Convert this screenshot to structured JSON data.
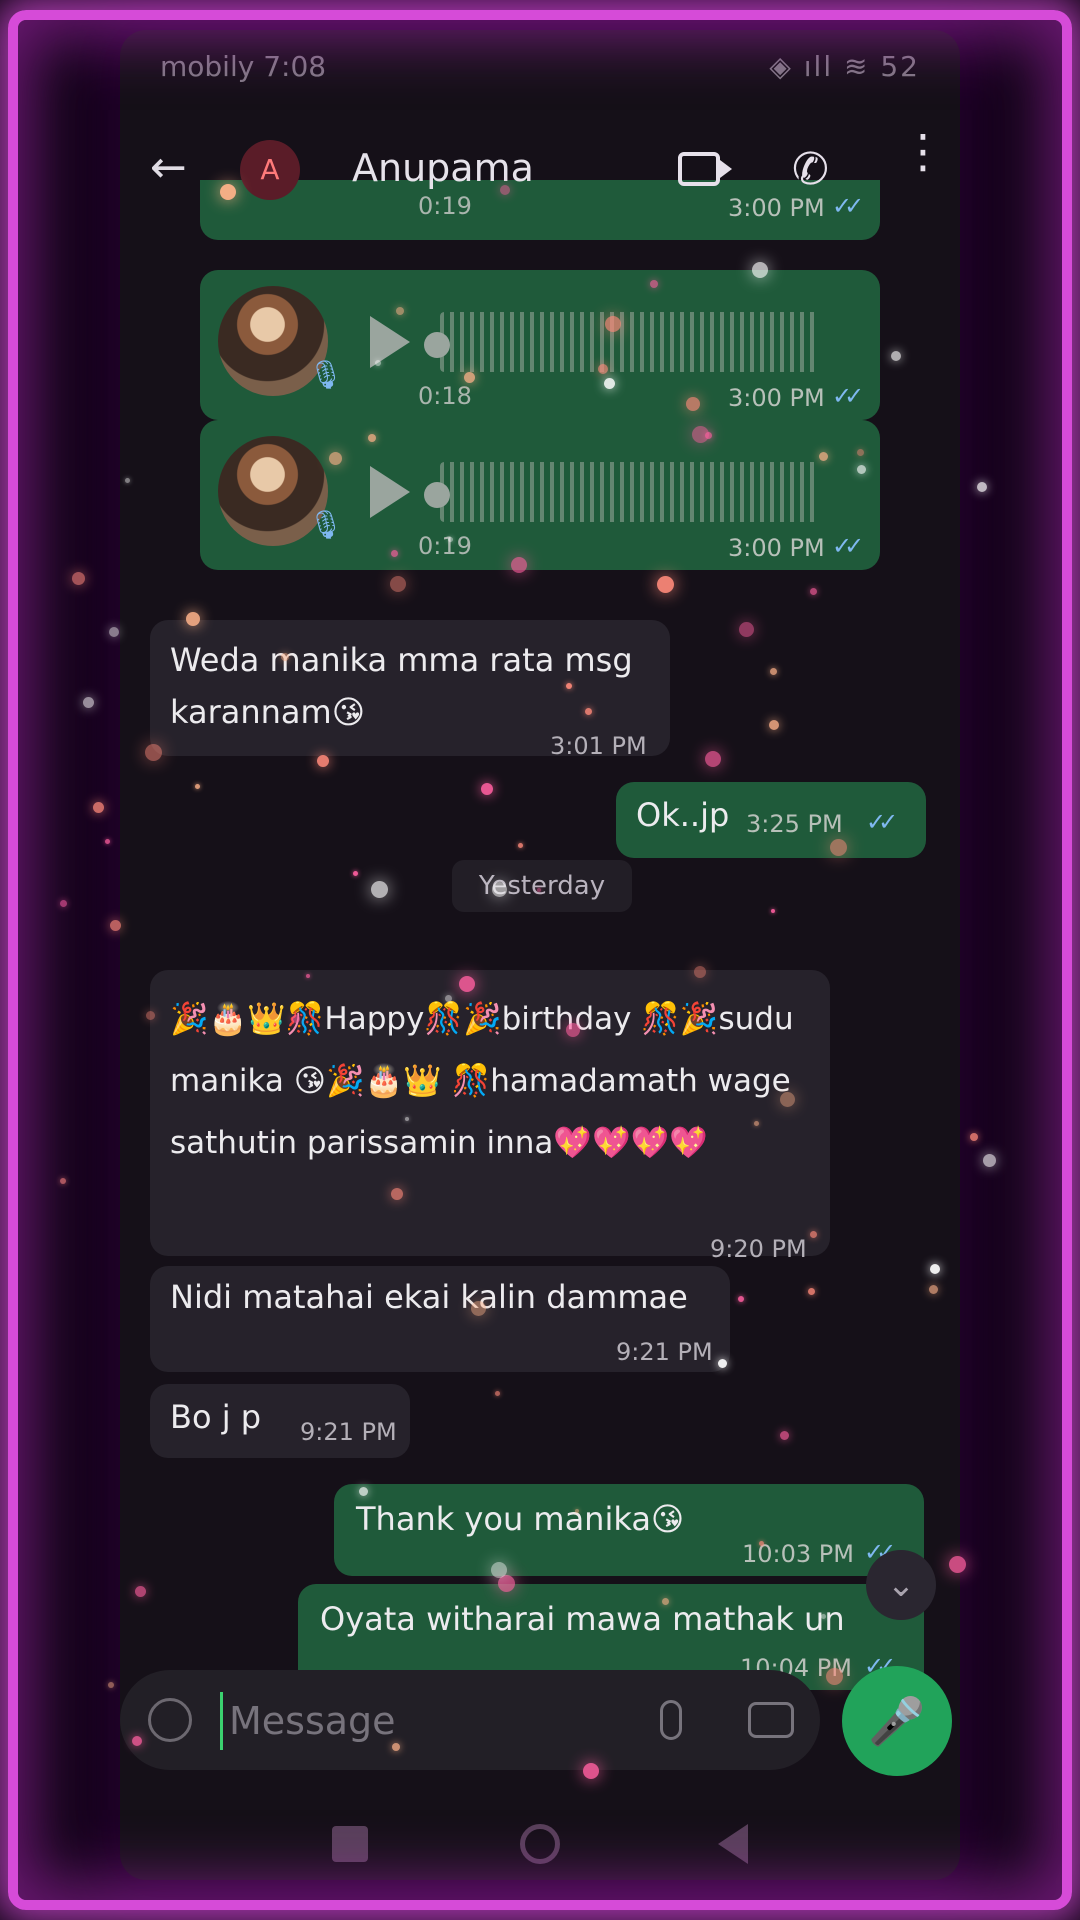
{
  "status_bar": {
    "carrier_time": "mobily  7:08",
    "indicators": "◈ ıll ≋ 52"
  },
  "header": {
    "contact_name": "Anupama",
    "avatar_initial": "A"
  },
  "voice_notes": [
    {
      "duration": "0:19",
      "time": "3:00 PM",
      "ticks": "✓✓"
    },
    {
      "duration": "0:18",
      "time": "3:00 PM",
      "ticks": "✓✓"
    },
    {
      "duration": "0:19",
      "time": "3:00 PM",
      "ticks": "✓✓"
    }
  ],
  "messages": [
    {
      "direction": "in",
      "text": "Weda manika mma rata msg karannam😘",
      "time": "3:01 PM"
    },
    {
      "direction": "out",
      "text": "Ok..jp",
      "time": "3:25 PM",
      "ticks": "✓✓"
    },
    {
      "direction": "in",
      "text": "🎉🎂👑🎊Happy🎊🎉birthday 🎊🎉sudu manika 😘🎉🎂👑 🎊hamadamath wage sathutin parissamin inna💖💖💖💖",
      "time": "9:20 PM"
    },
    {
      "direction": "in",
      "text": "Nidi matahai ekai kalin dammae",
      "time": "9:21 PM"
    },
    {
      "direction": "in",
      "text": "Bo j p",
      "time": "9:21 PM"
    },
    {
      "direction": "out",
      "text": "Thank you manika😘",
      "time": "10:03 PM",
      "ticks": "✓✓"
    },
    {
      "direction": "out",
      "text": "Oyata witharai mawa mathak un",
      "time": "10:04 PM",
      "ticks": "✓✓"
    }
  ],
  "date_chip": "Yesterday",
  "composer": {
    "placeholder": "Message"
  },
  "icons": {
    "back": "back-arrow-icon",
    "video": "video-call-icon",
    "call": "phone-icon",
    "more": "more-vert-icon",
    "play": "play-icon",
    "emoji": "emoji-icon",
    "attach": "attach-icon",
    "camera": "camera-icon",
    "mic": "mic-icon"
  },
  "colors": {
    "outgoing": "#1f5a3a",
    "incoming": "#26222b",
    "frame": "#d64bd8",
    "mic_button": "#21a35a",
    "ticks": "#7fb8f0"
  }
}
